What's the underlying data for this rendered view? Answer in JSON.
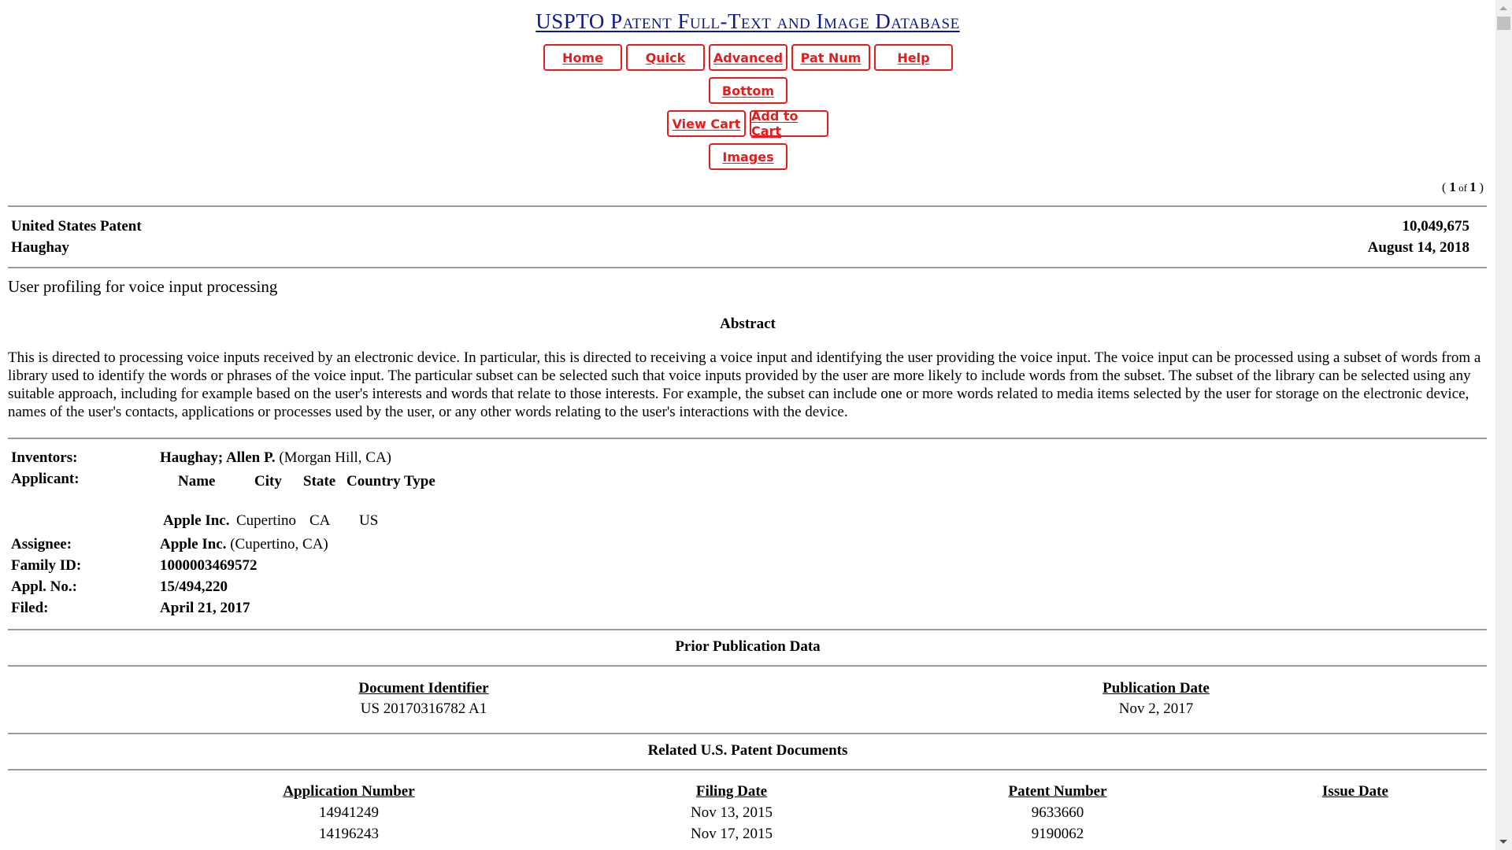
{
  "header": {
    "site_title": "USPTO Patent Full-Text and Image Database",
    "nav_buttons": [
      "Home",
      "Quick",
      "Advanced",
      "Pat Num",
      "Help"
    ],
    "bottom_button": "Bottom",
    "view_cart_button": "View Cart",
    "add_to_cart_button": "Add to Cart",
    "images_button": "Images",
    "colors": {
      "title": "#0b1a8a",
      "button": "#e41c1c"
    }
  },
  "pager": {
    "open": "( ",
    "current": "1",
    "of": " of ",
    "total": "1",
    "close": " )"
  },
  "patent": {
    "type_label": "United States Patent",
    "inventor_surname": "Haughay",
    "number": "10,049,675",
    "date": "August 14, 2018",
    "title": "User profiling for voice input processing"
  },
  "abstract": {
    "heading": "Abstract",
    "text": "This is directed to processing voice inputs received by an electronic device. In particular, this is directed to receiving a voice input and identifying the user providing the voice input. The voice input can be processed using a subset of words from a library used to identify the words or phrases of the voice input. The particular subset can be selected such that voice inputs provided by the user are more likely to include words from the subset. The subset of the library can be selected using any suitable approach, including for example based on the user's interests and words that relate to those interests. For example, the subset can include one or more words related to media items selected by the user for storage on the electronic device, names of the user's contacts, applications or processes used by the user, or any other words relating to the user's interactions with the device."
  },
  "details": {
    "inventors_label": "Inventors:",
    "inventors_name": "Haughay; Allen P.",
    "inventors_location": " (Morgan Hill, CA)",
    "applicant_label": "Applicant:",
    "applicant_headers": [
      "Name",
      "City",
      "State",
      "Country",
      "Type"
    ],
    "applicant_row": {
      "name": "Apple Inc.",
      "city": "Cupertino",
      "state": "CA",
      "country": "US",
      "type": ""
    },
    "assignee_label": "Assignee:",
    "assignee_name": "Apple Inc.",
    "assignee_location": " (Cupertino, CA)",
    "family_id_label": "Family ID:",
    "family_id": "1000003469572",
    "appl_no_label": "Appl. No.:",
    "appl_no": "15/494,220",
    "filed_label": "Filed:",
    "filed": "April 21, 2017"
  },
  "prior_publication": {
    "heading": "Prior Publication Data",
    "columns": [
      "Document Identifier",
      "Publication Date"
    ],
    "rows": [
      {
        "document_identifier": "US 20170316782 A1",
        "publication_date": "Nov 2, 2017"
      }
    ]
  },
  "related_documents": {
    "heading": "Related U.S. Patent Documents",
    "columns": [
      "Application Number",
      "Filing Date",
      "Patent Number",
      "Issue Date"
    ],
    "rows": [
      {
        "application_number": "14941249",
        "filing_date": "Nov 13, 2015",
        "patent_number": "9633660",
        "issue_date": ""
      },
      {
        "application_number": "14196243",
        "filing_date": "Nov 17, 2015",
        "patent_number": "9190062",
        "issue_date": ""
      }
    ]
  }
}
